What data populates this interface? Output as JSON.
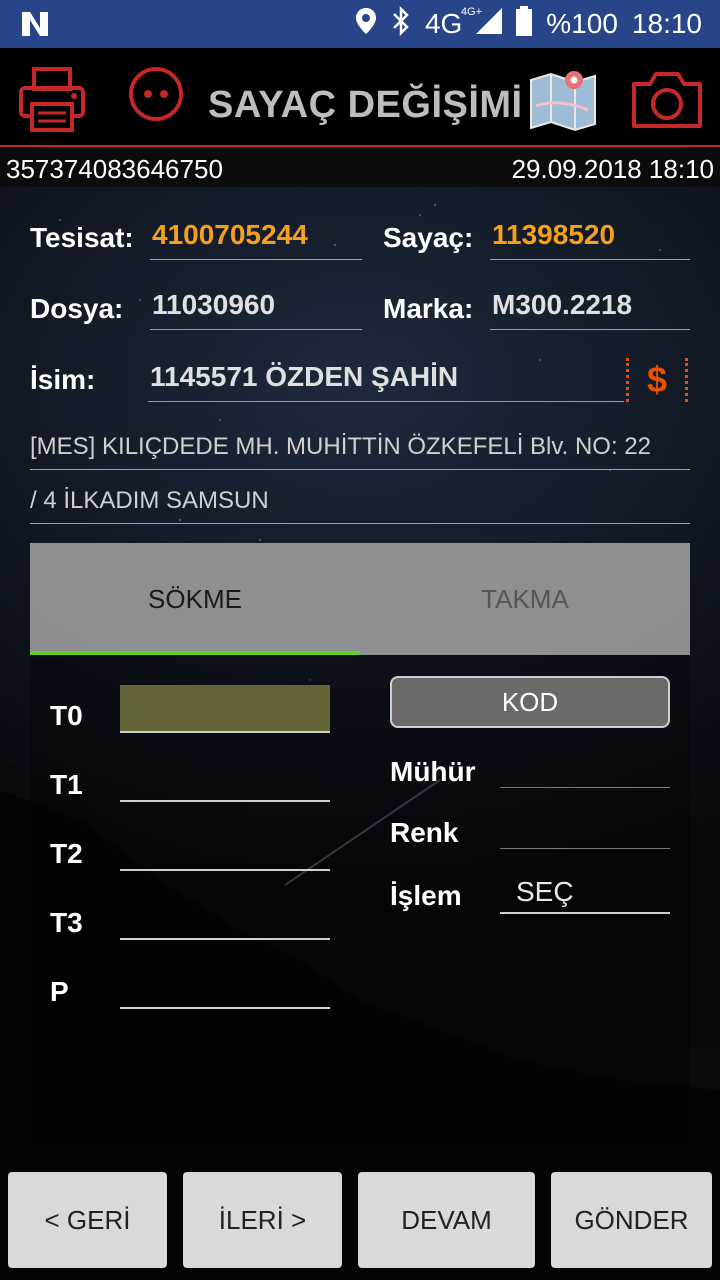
{
  "status_bar": {
    "left_icon": "n-logo-icon",
    "network": "4G",
    "network_sub": "4G+",
    "battery": "%100",
    "time": "18:10"
  },
  "header": {
    "title": "SAYAÇ DEĞİŞİMİ",
    "accent_color": "#c62828"
  },
  "info": {
    "imei": "357374083646750",
    "datetime": "29.09.2018 18:10"
  },
  "form": {
    "tesisat_label": "Tesisat:",
    "tesisat_value": "4100705244",
    "sayac_label": "Sayaç:",
    "sayac_value": "11398520",
    "dosya_label": "Dosya:",
    "dosya_value": "11030960",
    "marka_label": "Marka:",
    "marka_value": "M300.2218",
    "isim_label": "İsim:",
    "isim_value": "1145571 ÖZDEN ŞAHİN",
    "dollar": "$",
    "address_line1": "[MES] KILIÇDEDE MH. MUHİTTİN ÖZKEFELİ Blv. NO: 22",
    "address_line2": "/ 4 İLKADIM SAMSUN"
  },
  "tabs": {
    "active": "SÖKME",
    "inactive": "TAKMA",
    "underline_color": "#5bd12a"
  },
  "panel": {
    "t0": "T0",
    "t1": "T1",
    "t2": "T2",
    "t3": "T3",
    "p": "P",
    "kod": "KOD",
    "muhur": "Mühür",
    "renk": "Renk",
    "islem": "İşlem",
    "islem_value": "SEÇ"
  },
  "buttons": {
    "geri": "< GERİ",
    "ileri": "İLERİ >",
    "devam": "DEVAM",
    "gonder": "GÖNDER"
  }
}
